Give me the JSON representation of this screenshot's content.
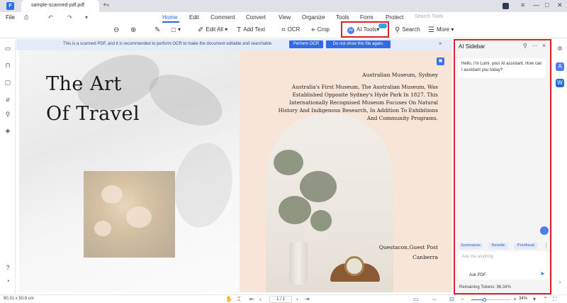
{
  "window": {
    "tab_title": "sample-scanned-pdf.pdf",
    "tab_close": "×",
    "tab_add": "+",
    "controls": [
      "≡",
      "—",
      "□",
      "✕"
    ]
  },
  "menu": {
    "file": "File",
    "quick_icons": [
      "⎙",
      "↶",
      "↷",
      "▾"
    ],
    "items": [
      "Home",
      "Edit",
      "Comment",
      "Convert",
      "View",
      "Organize",
      "Tools",
      "Form",
      "Protect"
    ],
    "active": "Home",
    "search_placeholder": "Search Tools"
  },
  "toolbar": {
    "zoom_out_icon": "⊖",
    "zoom_in_icon": "⊕",
    "highlight_icon": "✎",
    "shape_icon": "□",
    "edit_all": "Edit All",
    "add_text": "Add Text",
    "ocr": "OCR",
    "crop": "Crop",
    "ai_tools": "AI Tools",
    "search": "Search",
    "more": "More"
  },
  "ocr_banner": {
    "message": "This is a scanned PDF, and it is recommended to perform OCR to make the document editable and searchable.",
    "perform_button": "Perform OCR",
    "dismiss_button": "Do not show this file again.",
    "close": "×"
  },
  "document": {
    "left_page": {
      "title_line1": "The Art",
      "title_line2": "Of Travel"
    },
    "right_page": {
      "heading": "Australian Museum, Sydney",
      "body": "Australia's First Museum, The Australian Museum, Was Established Opposite Sydney's Hyde Park In 1827. This Internationally Recognised Museum Focuses On Natural History And Indigenous Research, In Addition To Exhibitions And Community Programs.",
      "caption_line1": "Questacon,Guest Post",
      "caption_line2": "Canberra"
    }
  },
  "ai_sidebar": {
    "title": "AI Sidebar",
    "header_icons": [
      "⚲",
      "⋯",
      "×"
    ],
    "greeting": "Hello, I'm Lumi, your AI assistant. How can I assistant you today?",
    "chips": [
      "Summarize",
      "Rewrite",
      "Proofread"
    ],
    "more": "⋮",
    "ask_placeholder": "Ask me anything",
    "ask_pdf": "Ask PDF",
    "send_icon": "➤",
    "remaining_tokens": "Remaining Tokens: 96.34%"
  },
  "statusbar": {
    "dimensions": "90.31 x 50.8 cm",
    "page_input": "1 / 1",
    "zoom_level": "34%",
    "zoom_fraction": 0.34
  },
  "colors": {
    "accent": "#2a66e8",
    "highlight_border": "#d9232d",
    "ocr_banner_bg": "#e4ecfb"
  }
}
